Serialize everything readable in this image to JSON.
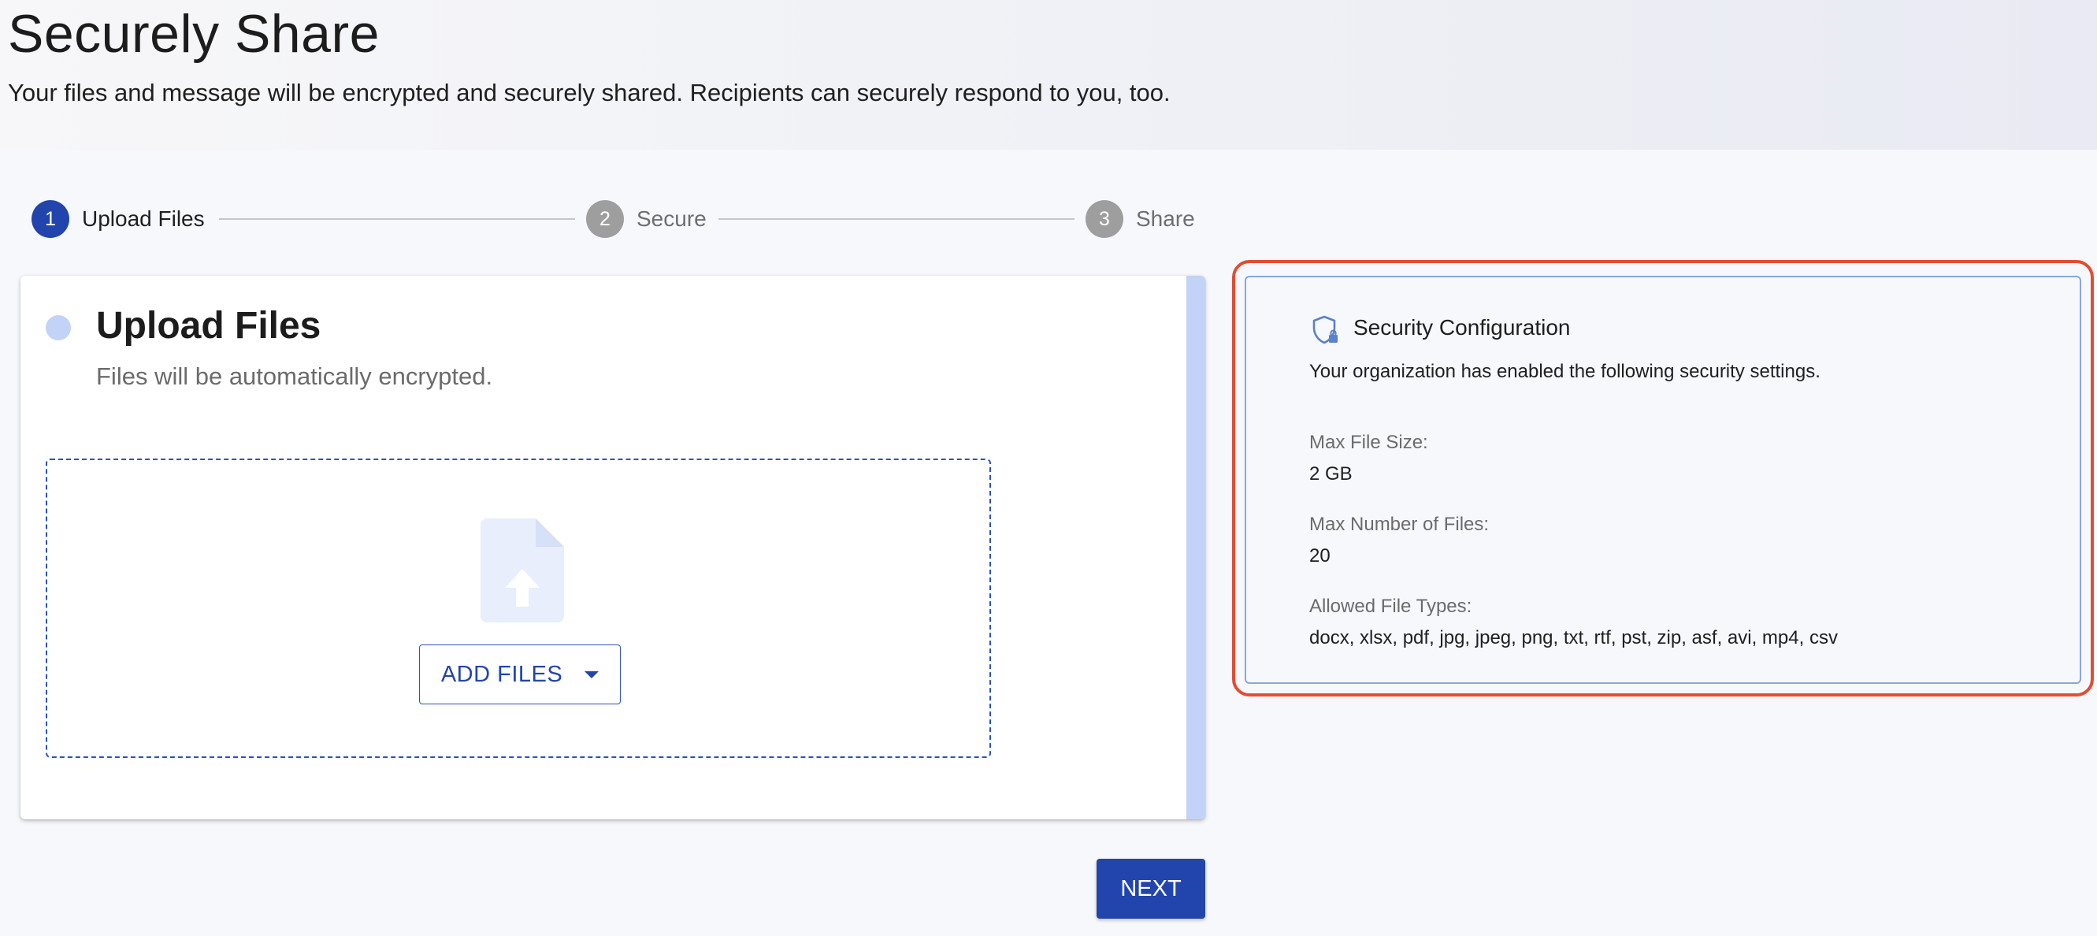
{
  "header": {
    "title": "Securely Share",
    "subtitle": "Your files and message will be encrypted and securely shared. Recipients can securely respond to you, too."
  },
  "stepper": {
    "steps": [
      {
        "number": "1",
        "label": "Upload Files",
        "state": "active"
      },
      {
        "number": "2",
        "label": "Secure",
        "state": "inactive"
      },
      {
        "number": "3",
        "label": "Share",
        "state": "inactive"
      }
    ]
  },
  "upload_card": {
    "title": "Upload Files",
    "subtitle": "Files will be automatically encrypted.",
    "icon": "file-upload-icon",
    "add_files_label": "ADD FILES",
    "add_files_icon": "chevron-down-icon"
  },
  "next_label": "NEXT",
  "security_panel": {
    "icon": "shield-lock-icon",
    "title": "Security Configuration",
    "description": "Your organization has enabled the following security settings.",
    "settings": [
      {
        "label": "Max File Size:",
        "value": "2 GB"
      },
      {
        "label": "Max Number of Files:",
        "value": "20"
      },
      {
        "label": "Allowed File Types:",
        "value": "docx, xlsx, pdf, jpg, jpeg, png, txt, rtf, pst, zip, asf, avi, mp4, csv"
      }
    ]
  },
  "colors": {
    "primary": "#2145ad",
    "accent_light": "#c3d2f7",
    "step_inactive": "#9e9e9e",
    "highlight": "#e24d33"
  }
}
